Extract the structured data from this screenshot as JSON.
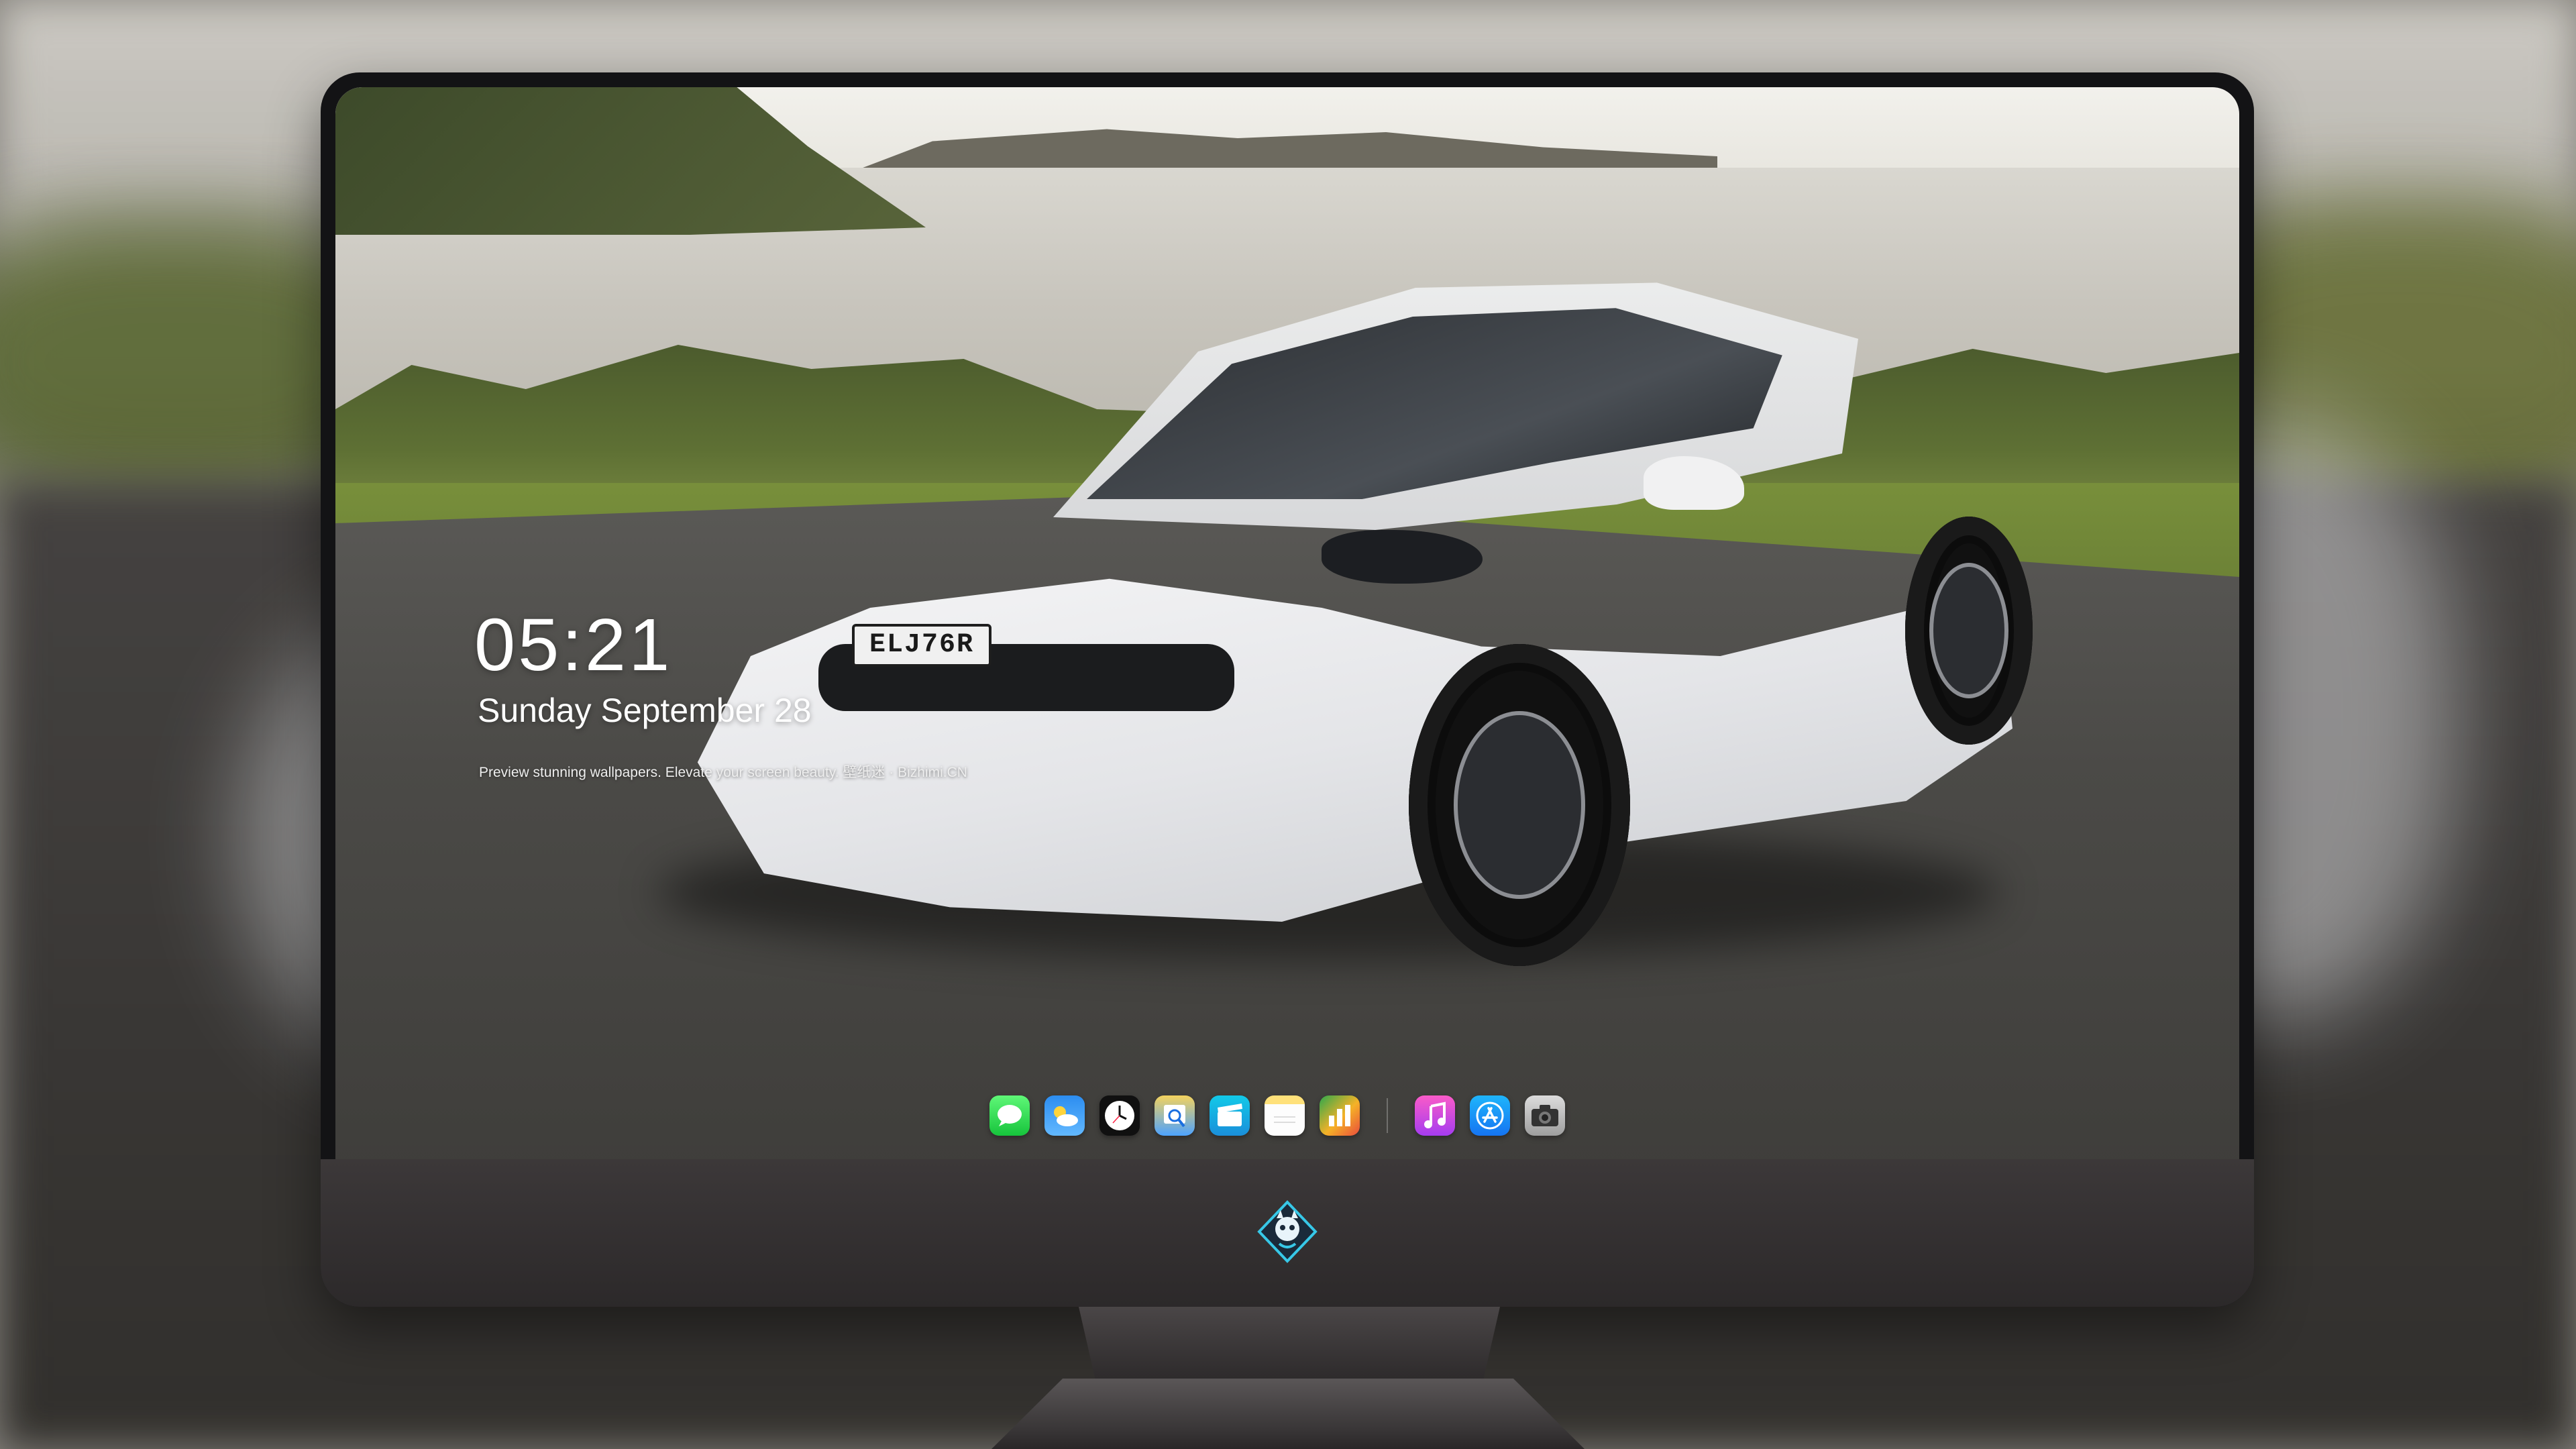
{
  "lockscreen": {
    "time": "05:21",
    "date": "Sunday September  28",
    "tagline": "Preview stunning wallpapers. Elevate your screen beauty. 壁纸迷 · Bizhimi.CN"
  },
  "wallpaper": {
    "plate_text": "ELJ76R"
  },
  "dock": {
    "apps": [
      {
        "name": "messages-icon"
      },
      {
        "name": "weather-icon"
      },
      {
        "name": "clock-icon"
      },
      {
        "name": "preview-icon"
      },
      {
        "name": "clips-icon"
      },
      {
        "name": "notes-icon"
      },
      {
        "name": "numbers-icon"
      },
      {
        "name": "music-icon"
      },
      {
        "name": "app-store-icon"
      },
      {
        "name": "camera-icon"
      }
    ]
  },
  "colors": {
    "bezel": "#131315",
    "chin": "#333031",
    "logo_accent": "#37c8e8"
  }
}
